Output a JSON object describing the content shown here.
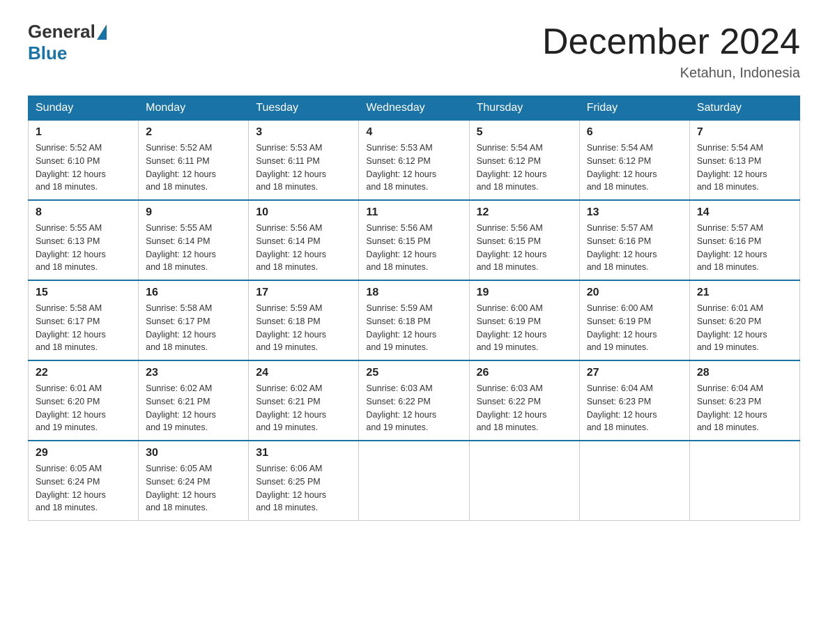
{
  "header": {
    "logo_general": "General",
    "logo_blue": "Blue",
    "month_title": "December 2024",
    "location": "Ketahun, Indonesia"
  },
  "columns": [
    "Sunday",
    "Monday",
    "Tuesday",
    "Wednesday",
    "Thursday",
    "Friday",
    "Saturday"
  ],
  "weeks": [
    [
      {
        "day": "1",
        "sunrise": "5:52 AM",
        "sunset": "6:10 PM",
        "daylight": "12 hours and 18 minutes."
      },
      {
        "day": "2",
        "sunrise": "5:52 AM",
        "sunset": "6:11 PM",
        "daylight": "12 hours and 18 minutes."
      },
      {
        "day": "3",
        "sunrise": "5:53 AM",
        "sunset": "6:11 PM",
        "daylight": "12 hours and 18 minutes."
      },
      {
        "day": "4",
        "sunrise": "5:53 AM",
        "sunset": "6:12 PM",
        "daylight": "12 hours and 18 minutes."
      },
      {
        "day": "5",
        "sunrise": "5:54 AM",
        "sunset": "6:12 PM",
        "daylight": "12 hours and 18 minutes."
      },
      {
        "day": "6",
        "sunrise": "5:54 AM",
        "sunset": "6:12 PM",
        "daylight": "12 hours and 18 minutes."
      },
      {
        "day": "7",
        "sunrise": "5:54 AM",
        "sunset": "6:13 PM",
        "daylight": "12 hours and 18 minutes."
      }
    ],
    [
      {
        "day": "8",
        "sunrise": "5:55 AM",
        "sunset": "6:13 PM",
        "daylight": "12 hours and 18 minutes."
      },
      {
        "day": "9",
        "sunrise": "5:55 AM",
        "sunset": "6:14 PM",
        "daylight": "12 hours and 18 minutes."
      },
      {
        "day": "10",
        "sunrise": "5:56 AM",
        "sunset": "6:14 PM",
        "daylight": "12 hours and 18 minutes."
      },
      {
        "day": "11",
        "sunrise": "5:56 AM",
        "sunset": "6:15 PM",
        "daylight": "12 hours and 18 minutes."
      },
      {
        "day": "12",
        "sunrise": "5:56 AM",
        "sunset": "6:15 PM",
        "daylight": "12 hours and 18 minutes."
      },
      {
        "day": "13",
        "sunrise": "5:57 AM",
        "sunset": "6:16 PM",
        "daylight": "12 hours and 18 minutes."
      },
      {
        "day": "14",
        "sunrise": "5:57 AM",
        "sunset": "6:16 PM",
        "daylight": "12 hours and 18 minutes."
      }
    ],
    [
      {
        "day": "15",
        "sunrise": "5:58 AM",
        "sunset": "6:17 PM",
        "daylight": "12 hours and 18 minutes."
      },
      {
        "day": "16",
        "sunrise": "5:58 AM",
        "sunset": "6:17 PM",
        "daylight": "12 hours and 18 minutes."
      },
      {
        "day": "17",
        "sunrise": "5:59 AM",
        "sunset": "6:18 PM",
        "daylight": "12 hours and 19 minutes."
      },
      {
        "day": "18",
        "sunrise": "5:59 AM",
        "sunset": "6:18 PM",
        "daylight": "12 hours and 19 minutes."
      },
      {
        "day": "19",
        "sunrise": "6:00 AM",
        "sunset": "6:19 PM",
        "daylight": "12 hours and 19 minutes."
      },
      {
        "day": "20",
        "sunrise": "6:00 AM",
        "sunset": "6:19 PM",
        "daylight": "12 hours and 19 minutes."
      },
      {
        "day": "21",
        "sunrise": "6:01 AM",
        "sunset": "6:20 PM",
        "daylight": "12 hours and 19 minutes."
      }
    ],
    [
      {
        "day": "22",
        "sunrise": "6:01 AM",
        "sunset": "6:20 PM",
        "daylight": "12 hours and 19 minutes."
      },
      {
        "day": "23",
        "sunrise": "6:02 AM",
        "sunset": "6:21 PM",
        "daylight": "12 hours and 19 minutes."
      },
      {
        "day": "24",
        "sunrise": "6:02 AM",
        "sunset": "6:21 PM",
        "daylight": "12 hours and 19 minutes."
      },
      {
        "day": "25",
        "sunrise": "6:03 AM",
        "sunset": "6:22 PM",
        "daylight": "12 hours and 19 minutes."
      },
      {
        "day": "26",
        "sunrise": "6:03 AM",
        "sunset": "6:22 PM",
        "daylight": "12 hours and 18 minutes."
      },
      {
        "day": "27",
        "sunrise": "6:04 AM",
        "sunset": "6:23 PM",
        "daylight": "12 hours and 18 minutes."
      },
      {
        "day": "28",
        "sunrise": "6:04 AM",
        "sunset": "6:23 PM",
        "daylight": "12 hours and 18 minutes."
      }
    ],
    [
      {
        "day": "29",
        "sunrise": "6:05 AM",
        "sunset": "6:24 PM",
        "daylight": "12 hours and 18 minutes."
      },
      {
        "day": "30",
        "sunrise": "6:05 AM",
        "sunset": "6:24 PM",
        "daylight": "12 hours and 18 minutes."
      },
      {
        "day": "31",
        "sunrise": "6:06 AM",
        "sunset": "6:25 PM",
        "daylight": "12 hours and 18 minutes."
      },
      null,
      null,
      null,
      null
    ]
  ]
}
